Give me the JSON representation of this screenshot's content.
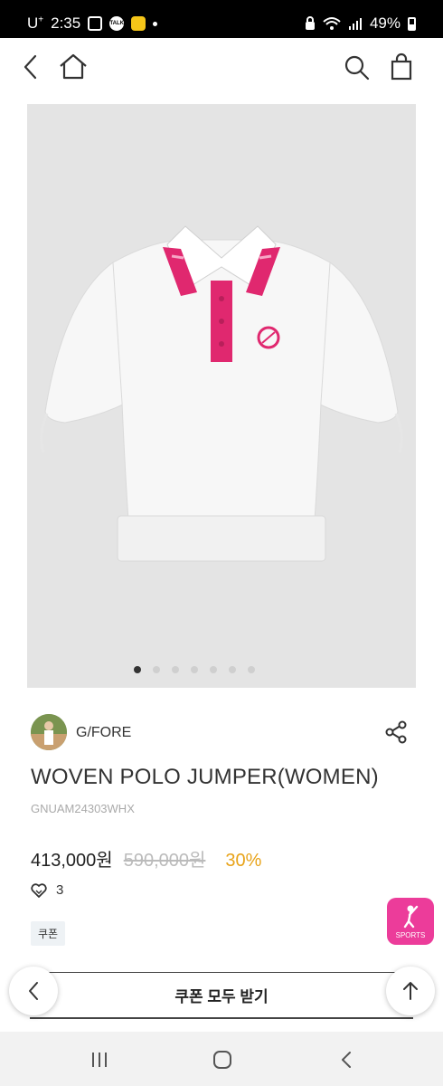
{
  "status_bar": {
    "carrier": "U",
    "carrier_sup": "+",
    "time": "2:35",
    "talk_icon_text": "TALK",
    "battery": "49%"
  },
  "header": {
    "back_icon": "chevron-left-icon",
    "home_icon": "home-icon",
    "search_icon": "search-icon",
    "cart_icon": "shopping-bag-icon"
  },
  "gallery": {
    "image_count": 7,
    "active_index": 0,
    "image_description_icon": "polo-jumper-image",
    "colors": {
      "background": "#e4e4e4",
      "garment": "#f7f7f7",
      "accent": "#e0286f"
    }
  },
  "brand": {
    "name": "G/FORE",
    "share_icon": "share-icon"
  },
  "product": {
    "title": "WOVEN POLO JUMPER(WOMEN)",
    "code": "GNUAM24303WHX",
    "price": "413,000원",
    "original_price": "590,000원",
    "discount": "30%",
    "likes": "3",
    "coupon_tag": "쿠폰"
  },
  "sports_badge": {
    "label": "SPORTS",
    "color": "#ec3c9a"
  },
  "coupon_bar": {
    "label": "쿠폰 모두 받기"
  },
  "floating": {
    "back_icon": "chevron-left-icon",
    "top_icon": "arrow-up-icon"
  },
  "nav_bar": {
    "recents_icon": "recents-icon",
    "home_icon": "home-circle-icon",
    "back_icon": "back-icon"
  }
}
